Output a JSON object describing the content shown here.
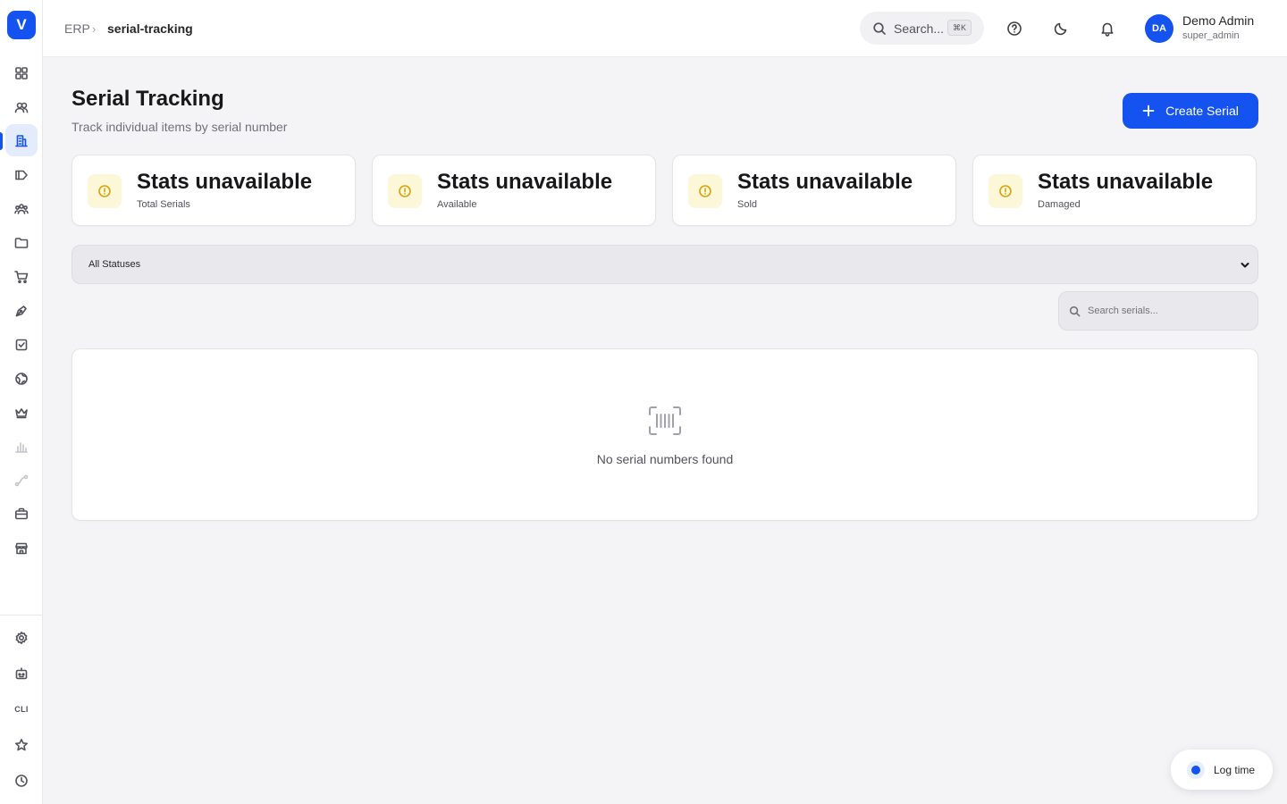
{
  "sidebar": {
    "logo_letter": "V",
    "cli_label": "CLI",
    "items": [
      {
        "name": "dashboard-icon"
      },
      {
        "name": "users-icon"
      },
      {
        "name": "building-icon"
      },
      {
        "name": "tag-icon"
      },
      {
        "name": "team-icon"
      },
      {
        "name": "folder-icon"
      },
      {
        "name": "cart-icon"
      },
      {
        "name": "pen-icon"
      },
      {
        "name": "checkbox-icon"
      },
      {
        "name": "globe-icon"
      },
      {
        "name": "crown-icon"
      },
      {
        "name": "bar-chart-icon"
      },
      {
        "name": "route-icon"
      },
      {
        "name": "briefcase-icon"
      },
      {
        "name": "store-icon"
      }
    ],
    "bottom_items": [
      {
        "name": "settings-icon"
      },
      {
        "name": "bot-icon"
      },
      {
        "name": "cli-icon"
      },
      {
        "name": "star-icon"
      },
      {
        "name": "clock-icon"
      }
    ]
  },
  "header": {
    "breadcrumb_root": "ERP",
    "breadcrumb_separator": "›",
    "breadcrumb_current": "serial-tracking",
    "search_placeholder": "Search...",
    "search_shortcut": "⌘K",
    "user_initials": "DA",
    "user_name": "Demo Admin",
    "user_role": "super_admin"
  },
  "page": {
    "title": "Serial Tracking",
    "subtitle": "Track individual items by serial number",
    "create_button": "Create Serial"
  },
  "stats": [
    {
      "value": "Stats unavailable",
      "label": "Total Serials"
    },
    {
      "value": "Stats unavailable",
      "label": "Available"
    },
    {
      "value": "Stats unavailable",
      "label": "Sold"
    },
    {
      "value": "Stats unavailable",
      "label": "Damaged"
    }
  ],
  "filters": {
    "status_selected": "All Statuses",
    "search_placeholder": "Search serials..."
  },
  "table": {
    "empty_message": "No serial numbers found"
  },
  "floating": {
    "log_time_label": "Log time"
  },
  "colors": {
    "accent": "#1553f0",
    "warning": "#d9a406",
    "background": "#f4f4f7"
  }
}
